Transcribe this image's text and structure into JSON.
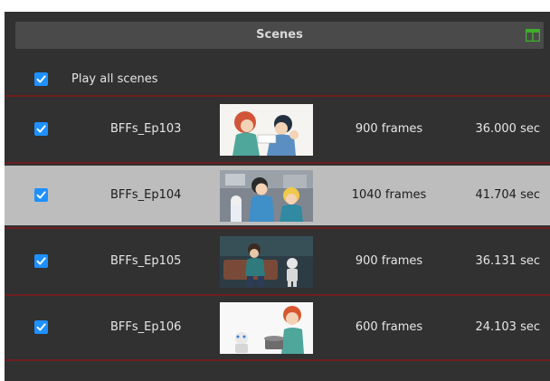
{
  "panel": {
    "title": "Scenes",
    "layout_icon": "split-view-icon",
    "play_all": {
      "label": "Play all scenes",
      "checked": true
    }
  },
  "scenes": [
    {
      "name": "BFFs_Ep103",
      "frames": "900 frames",
      "duration": "36.000 sec",
      "checked": true,
      "selected": false
    },
    {
      "name": "BFFs_Ep104",
      "frames": "1040 frames",
      "duration": "41.704 sec",
      "checked": true,
      "selected": true
    },
    {
      "name": "BFFs_Ep105",
      "frames": "900 frames",
      "duration": "36.131 sec",
      "checked": true,
      "selected": false
    },
    {
      "name": "BFFs_Ep106",
      "frames": "600 frames",
      "duration": "24.103 sec",
      "checked": true,
      "selected": false
    }
  ],
  "colors": {
    "panel_bg": "#313131",
    "header_bg": "#4a4a4a",
    "divider": "#6e1e1e",
    "checkbox": "#1e90ff",
    "selected_row": "#bdbdbd",
    "layout_icon": "#3fae2a"
  }
}
